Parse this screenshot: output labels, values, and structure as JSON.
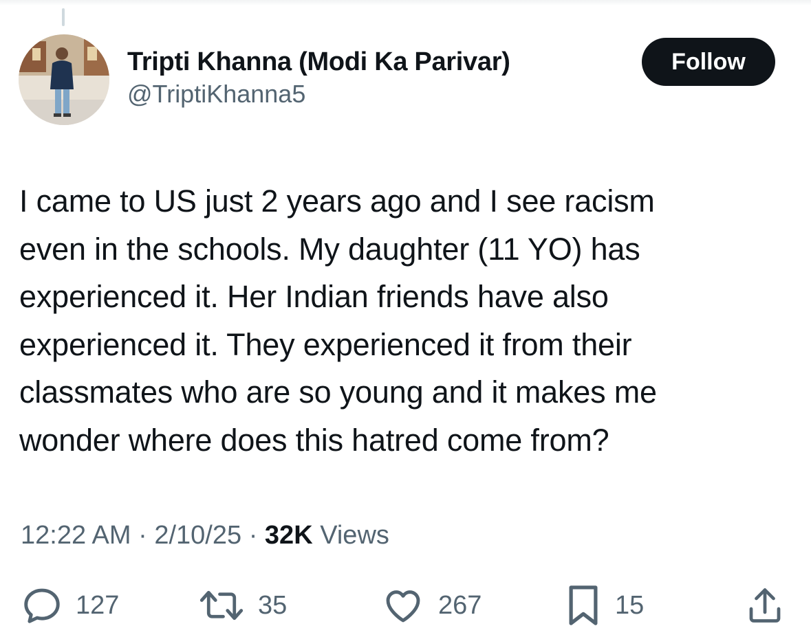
{
  "tweet": {
    "author": {
      "display_name": "Tripti Khanna (Modi Ka Parivar)",
      "handle": "@TriptiKhanna5"
    },
    "follow_label": "Follow",
    "text": "I came to US just 2 years ago and I see racism\neven in the schools. My daughter (11 YO) has\nexperienced it. Her Indian friends have also\nexperienced it. They experienced it from their\nclassmates who are so young and it makes me\nwonder where does this hatred come from?",
    "time": "12:22 AM",
    "separator": "·",
    "date": "2/10/25",
    "views_count": "32K",
    "views_label": "Views",
    "actions": {
      "reply": {
        "icon": "reply-icon",
        "count": "127"
      },
      "repost": {
        "icon": "repost-icon",
        "count": "35"
      },
      "like": {
        "icon": "heart-icon",
        "count": "267"
      },
      "bookmark": {
        "icon": "bookmark-icon",
        "count": "15"
      },
      "share": {
        "icon": "share-icon"
      }
    }
  },
  "colors": {
    "text": "#0f1419",
    "secondary": "#536471",
    "follow_bg": "#0f1419",
    "follow_text": "#ffffff"
  }
}
